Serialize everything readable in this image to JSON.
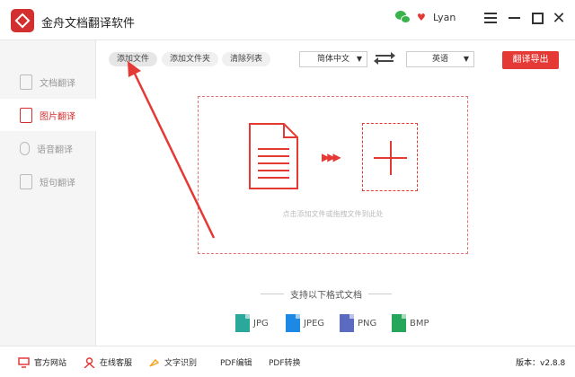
{
  "app": {
    "title": "金舟文档翻译软件"
  },
  "user": {
    "name": "Lyan"
  },
  "sidebar": {
    "items": [
      {
        "label": "文档翻译",
        "icon": "document-icon",
        "active": false
      },
      {
        "label": "图片翻译",
        "icon": "image-icon",
        "active": true
      },
      {
        "label": "语音翻译",
        "icon": "microphone-icon",
        "active": false
      },
      {
        "label": "短句翻译",
        "icon": "text-icon",
        "active": false
      }
    ]
  },
  "toolbar": {
    "add_file": "添加文件",
    "add_folder": "添加文件夹",
    "clear_list": "清除列表",
    "source_lang": "简体中文",
    "target_lang": "英语",
    "export_label": "翻译导出"
  },
  "dropzone": {
    "hint": "点击添加文件或拖拽文件到此处"
  },
  "formats": {
    "title": "支持以下格式文档",
    "items": [
      {
        "label": "JPG",
        "color": "#2aa89a"
      },
      {
        "label": "JPEG",
        "color": "#1e88e5"
      },
      {
        "label": "PNG",
        "color": "#5c6bc0"
      },
      {
        "label": "BMP",
        "color": "#26a65b"
      }
    ]
  },
  "statusbar": {
    "website": "官方网站",
    "support": "在线客服",
    "ocr": "文字识别",
    "pdf_edit": "PDF编辑",
    "pdf_convert": "PDF转换",
    "version_label": "版本：",
    "version": "v2.8.8"
  },
  "colors": {
    "accent": "#e53935",
    "sidebar_bg": "#f5f5f5"
  }
}
